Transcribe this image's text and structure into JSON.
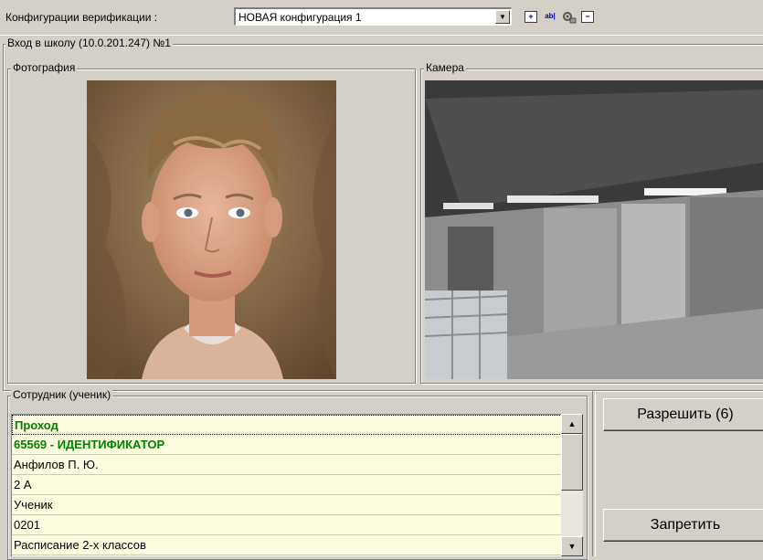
{
  "toolbar": {
    "config_label": "Конфигурации верификации :",
    "config_value": "НОВАЯ конфигурация 1",
    "icons": [
      "add-icon",
      "rename-icon",
      "settings-icon",
      "remove-icon"
    ]
  },
  "point": {
    "title": "Вход в школу (10.0.201.247) №1"
  },
  "photo": {
    "title": "Фотография"
  },
  "camera": {
    "title": "Камера"
  },
  "employee": {
    "title": "Сотрудник (ученик)",
    "rows": [
      "Проход",
      "65569 - ИДЕНТИФИКАТОР",
      "Анфилов П. Ю.",
      "2 А",
      "Ученик",
      "0201",
      "Расписание 2-х классов"
    ]
  },
  "actions": {
    "allow_label": "Разрешить (6)",
    "deny_label": "Запретить"
  },
  "colors": {
    "list_bg": "#fffde0",
    "green_text": "#008000",
    "window_bg": "#d4d0c8"
  }
}
